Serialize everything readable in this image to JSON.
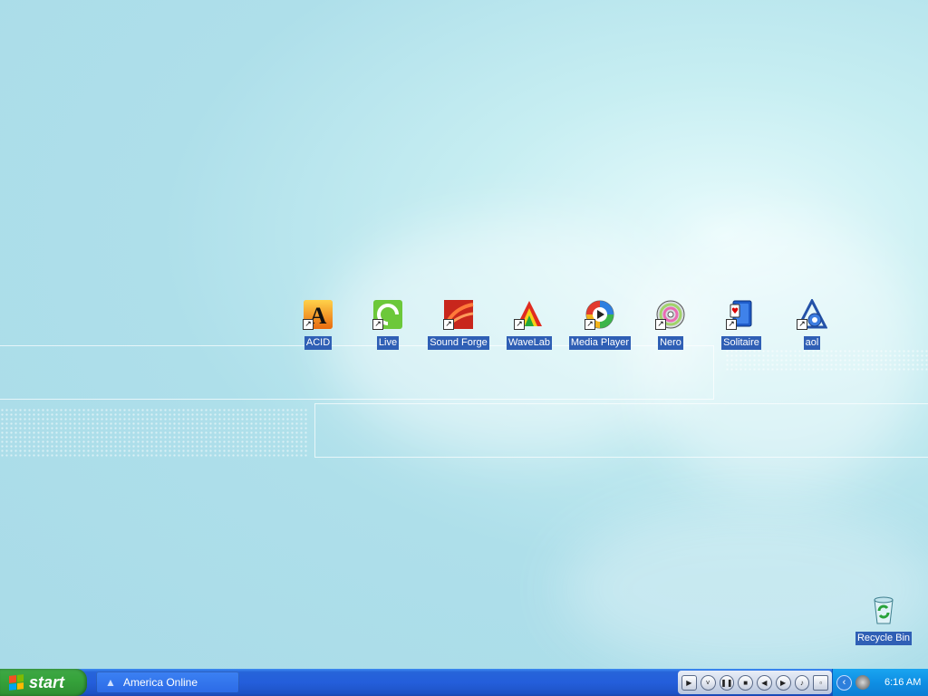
{
  "desktop": {
    "icons": [
      {
        "label": "ACID",
        "icon": "acid-icon"
      },
      {
        "label": "Live",
        "icon": "live-icon"
      },
      {
        "label": "Sound Forge",
        "icon": "sound-forge-icon"
      },
      {
        "label": "WaveLab",
        "icon": "wavelab-icon"
      },
      {
        "label": "Media Player",
        "icon": "media-player-icon"
      },
      {
        "label": "Nero",
        "icon": "nero-icon"
      },
      {
        "label": "Solitaire",
        "icon": "solitaire-icon"
      },
      {
        "label": "aol",
        "icon": "aol-icon"
      }
    ],
    "recycle_bin": {
      "label": "Recycle Bin",
      "icon": "recycle-bin-icon"
    }
  },
  "taskbar": {
    "start_label": "start",
    "tasks": [
      {
        "label": "America Online",
        "icon": "aol-icon"
      }
    ],
    "clock": "6:16 AM"
  },
  "colors": {
    "selection": "#2f5fb5",
    "taskbar": "#245edb",
    "start": "#36a33b",
    "tray": "#0f8fe4"
  }
}
